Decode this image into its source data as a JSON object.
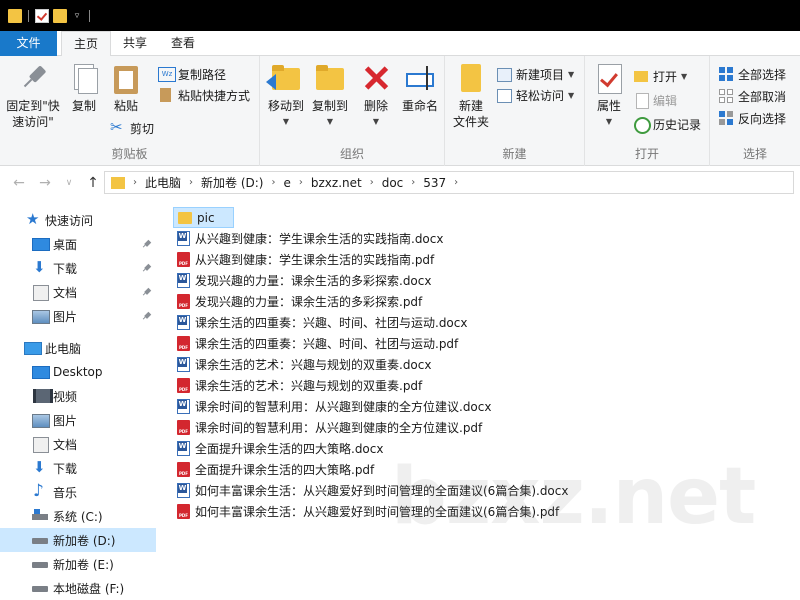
{
  "ribbon_tabs": {
    "file": "文件",
    "home": "主页",
    "share": "共享",
    "view": "查看"
  },
  "ribbon": {
    "clipboard": {
      "pin": "固定到\"快\n速访问\"",
      "copy": "复制",
      "paste": "粘贴",
      "copy_path": "复制路径",
      "paste_shortcut": "粘贴快捷方式",
      "cut": "剪切",
      "label": "剪贴板"
    },
    "organize": {
      "move_to": "移动到",
      "copy_to": "复制到",
      "delete": "删除",
      "rename": "重命名",
      "label": "组织"
    },
    "new": {
      "new_folder": "新建\n文件夹",
      "new_item": "新建项目",
      "easy_access": "轻松访问",
      "label": "新建"
    },
    "open": {
      "properties": "属性",
      "open": "打开",
      "edit": "编辑",
      "history": "历史记录",
      "label": "打开"
    },
    "select": {
      "select_all": "全部选择",
      "select_none": "全部取消",
      "invert": "反向选择",
      "label": "选择"
    }
  },
  "address": {
    "crumbs": [
      "此电脑",
      "新加卷 (D:)",
      "e",
      "bzxz.net",
      "doc",
      "537"
    ]
  },
  "sidebar": {
    "items": [
      {
        "label": "快速访问"
      },
      {
        "label": "桌面"
      },
      {
        "label": "下载"
      },
      {
        "label": "文档"
      },
      {
        "label": "图片"
      },
      {
        "label": "此电脑"
      },
      {
        "label": "Desktop"
      },
      {
        "label": "视频"
      },
      {
        "label": "图片"
      },
      {
        "label": "文档"
      },
      {
        "label": "下载"
      },
      {
        "label": "音乐"
      },
      {
        "label": "系统 (C:)"
      },
      {
        "label": "新加卷 (D:)"
      },
      {
        "label": "新加卷 (E:)"
      },
      {
        "label": "本地磁盘 (F:)"
      }
    ]
  },
  "files": [
    {
      "name": "pic",
      "type": "folder"
    },
    {
      "name": "从兴趣到健康：学生课余生活的实践指南.docx",
      "type": "docx"
    },
    {
      "name": "从兴趣到健康：学生课余生活的实践指南.pdf",
      "type": "pdf"
    },
    {
      "name": "发现兴趣的力量：课余生活的多彩探索.docx",
      "type": "docx"
    },
    {
      "name": "发现兴趣的力量：课余生活的多彩探索.pdf",
      "type": "pdf"
    },
    {
      "name": "课余生活的四重奏：兴趣、时间、社团与运动.docx",
      "type": "docx"
    },
    {
      "name": "课余生活的四重奏：兴趣、时间、社团与运动.pdf",
      "type": "pdf"
    },
    {
      "name": "课余生活的艺术：兴趣与规划的双重奏.docx",
      "type": "docx"
    },
    {
      "name": "课余生活的艺术：兴趣与规划的双重奏.pdf",
      "type": "pdf"
    },
    {
      "name": "课余时间的智慧利用：从兴趣到健康的全方位建议.docx",
      "type": "docx"
    },
    {
      "name": "课余时间的智慧利用：从兴趣到健康的全方位建议.pdf",
      "type": "pdf"
    },
    {
      "name": "全面提升课余生活的四大策略.docx",
      "type": "docx"
    },
    {
      "name": "全面提升课余生活的四大策略.pdf",
      "type": "pdf"
    },
    {
      "name": "如何丰富课余生活：从兴趣爱好到时间管理的全面建议(6篇合集).docx",
      "type": "docx"
    },
    {
      "name": "如何丰富课余生活：从兴趣爱好到时间管理的全面建议(6篇合集).pdf",
      "type": "pdf"
    }
  ],
  "watermark": "bzxz.net",
  "colors": {
    "accent": "#1979ca",
    "selection": "#cce8ff",
    "folder": "#f3c443",
    "pdf": "#d3272f",
    "word": "#2b579a"
  }
}
